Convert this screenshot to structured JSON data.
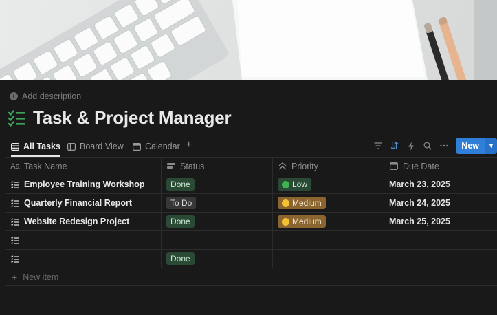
{
  "description": {
    "label": "Add description"
  },
  "page": {
    "title": "Task & Project Manager"
  },
  "views": [
    {
      "label": "All Tasks",
      "icon": "table-icon",
      "active": true
    },
    {
      "label": "Board View",
      "icon": "board-icon",
      "active": false
    },
    {
      "label": "Calendar",
      "icon": "calendar-icon",
      "active": false
    }
  ],
  "toolbar": {
    "add_view": "+",
    "new_label": "New"
  },
  "columns": [
    {
      "label": "Task Name",
      "icon": "text-icon"
    },
    {
      "label": "Status",
      "icon": "status-icon"
    },
    {
      "label": "Priority",
      "icon": "priority-icon"
    },
    {
      "label": "Due Date",
      "icon": "calendar-icon"
    }
  ],
  "rows": [
    {
      "name": "Employee Training Workshop",
      "status": "Done",
      "priority": "Low",
      "due": "March 23, 2025"
    },
    {
      "name": "Quarterly Financial Report",
      "status": "To Do",
      "priority": "Medium",
      "due": "March 24, 2025"
    },
    {
      "name": "Website Redesign Project",
      "status": "Done",
      "priority": "Medium",
      "due": "March 25, 2025"
    },
    {
      "name": "",
      "status": "",
      "priority": "",
      "due": ""
    },
    {
      "name": "",
      "status": "Done",
      "priority": "",
      "due": ""
    }
  ],
  "footer": {
    "new_item": "New item"
  },
  "colors": {
    "accent": "#2f7ed8",
    "done": "#2b4a36",
    "medium": "#8a6530",
    "background": "#191919"
  }
}
